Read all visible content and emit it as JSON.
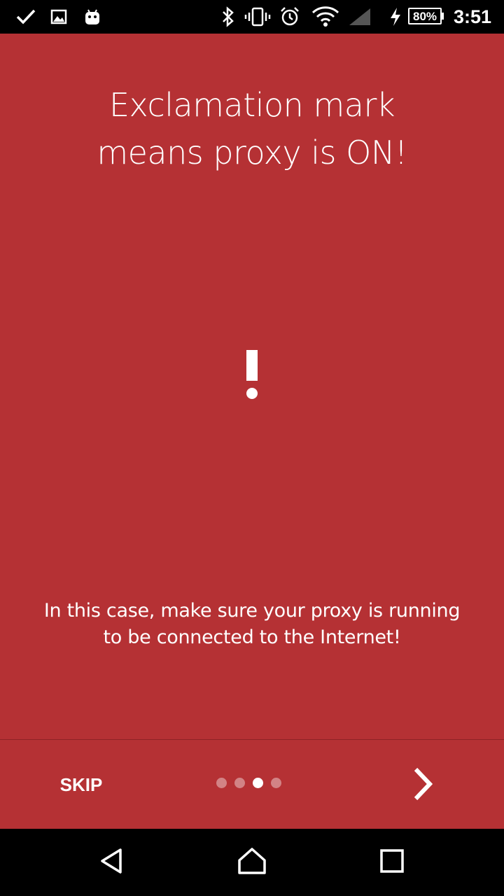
{
  "status_bar": {
    "icons": [
      "check-icon",
      "image-icon",
      "android-icon",
      "bluetooth-icon",
      "vibrate-icon",
      "alarm-icon",
      "wifi-icon",
      "signal-icon",
      "charging-icon"
    ],
    "battery": "80%",
    "time": "3:51"
  },
  "intro": {
    "title_line1": "Exclamation mark",
    "title_line2": "means proxy is ON!",
    "description_line1": "In this case, make sure your proxy is running",
    "description_line2": "to be connected to the Internet!"
  },
  "footer": {
    "skip_label": "SKIP",
    "page_count": 4,
    "active_page": 3
  },
  "colors": {
    "background": "#b53134",
    "foreground": "#ffffff"
  },
  "nav_bar": [
    "back-icon",
    "home-icon",
    "recents-icon"
  ]
}
